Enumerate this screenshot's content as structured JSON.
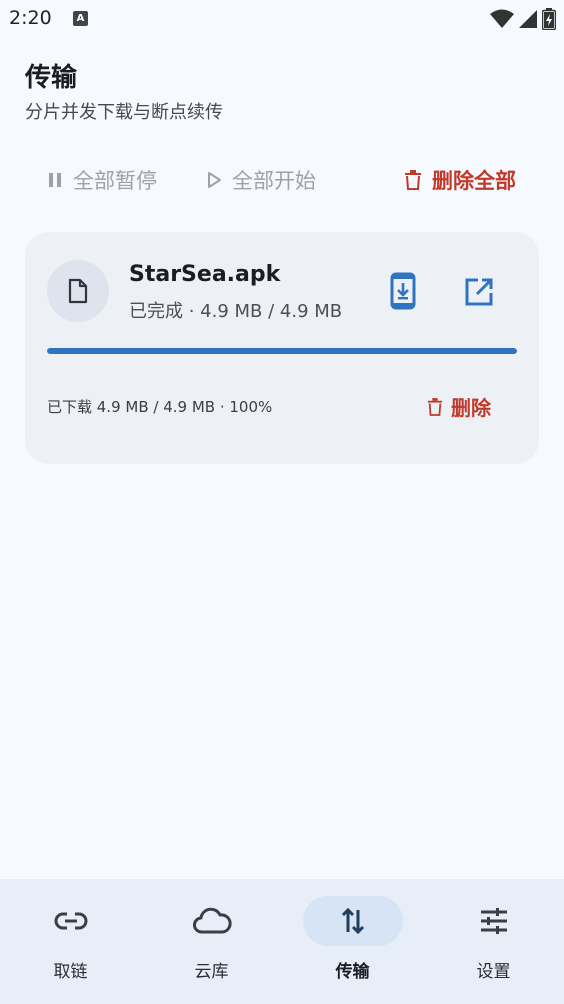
{
  "status_bar": {
    "time": "2:20",
    "notification_icon": "A"
  },
  "header": {
    "title": "传输",
    "subtitle": "分片并发下载与断点续传"
  },
  "actions": {
    "pause_all": "全部暂停",
    "start_all": "全部开始",
    "delete_all": "删除全部"
  },
  "transfer": {
    "file_name": "StarSea.apk",
    "status_line": "已完成 · 4.9 MB / 4.9 MB",
    "progress": 1.0,
    "progress_line": "已下载 4.9 MB / 4.9 MB · 100%",
    "delete_label": "删除"
  },
  "nav": {
    "items": [
      {
        "label": "取链",
        "icon": "link-icon"
      },
      {
        "label": "云库",
        "icon": "cloud-icon"
      },
      {
        "label": "传输",
        "icon": "swap-vertical-icon",
        "active": true
      },
      {
        "label": "设置",
        "icon": "sliders-icon"
      }
    ]
  },
  "colors": {
    "accent": "#2f73c1",
    "danger": "#c0392b",
    "background": "#f6f9fd",
    "card": "#edf1f6",
    "nav": "#e7eef7"
  }
}
